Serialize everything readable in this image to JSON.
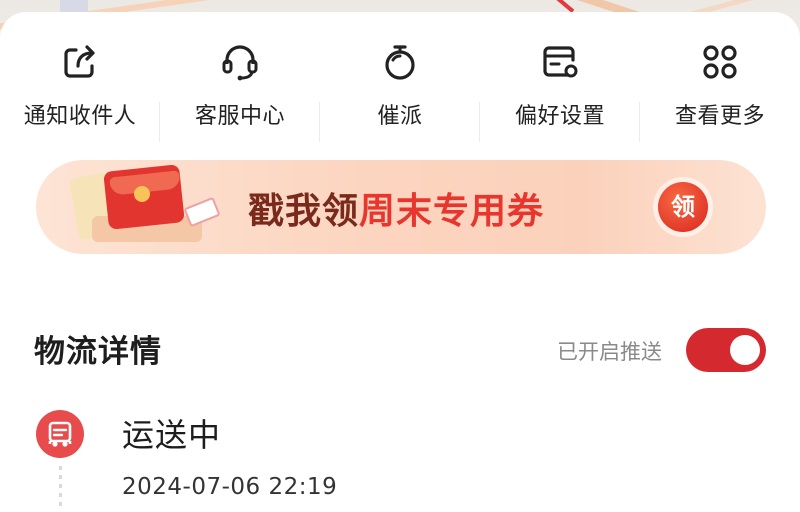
{
  "quick_actions": [
    {
      "label": "通知收件人",
      "icon": "share-icon"
    },
    {
      "label": "客服中心",
      "icon": "headset-icon"
    },
    {
      "label": "催派",
      "icon": "stopwatch-icon"
    },
    {
      "label": "偏好设置",
      "icon": "preference-card-icon"
    },
    {
      "label": "查看更多",
      "icon": "grid-icon"
    }
  ],
  "promo": {
    "title_part1": "戳我领",
    "title_part2": "周末专用券",
    "claim_label": "领"
  },
  "logistics": {
    "title": "物流详情",
    "push_status": "已开启推送",
    "push_enabled": true
  },
  "timeline": [
    {
      "status": "运送中",
      "time": "2024-07-06 22:19",
      "icon": "truck-icon"
    }
  ],
  "colors": {
    "accent": "#d42a2f",
    "banner_title_dark": "#7a2a1c",
    "banner_title_red": "#e8352d",
    "status_icon_bg": "#e74b4b"
  }
}
